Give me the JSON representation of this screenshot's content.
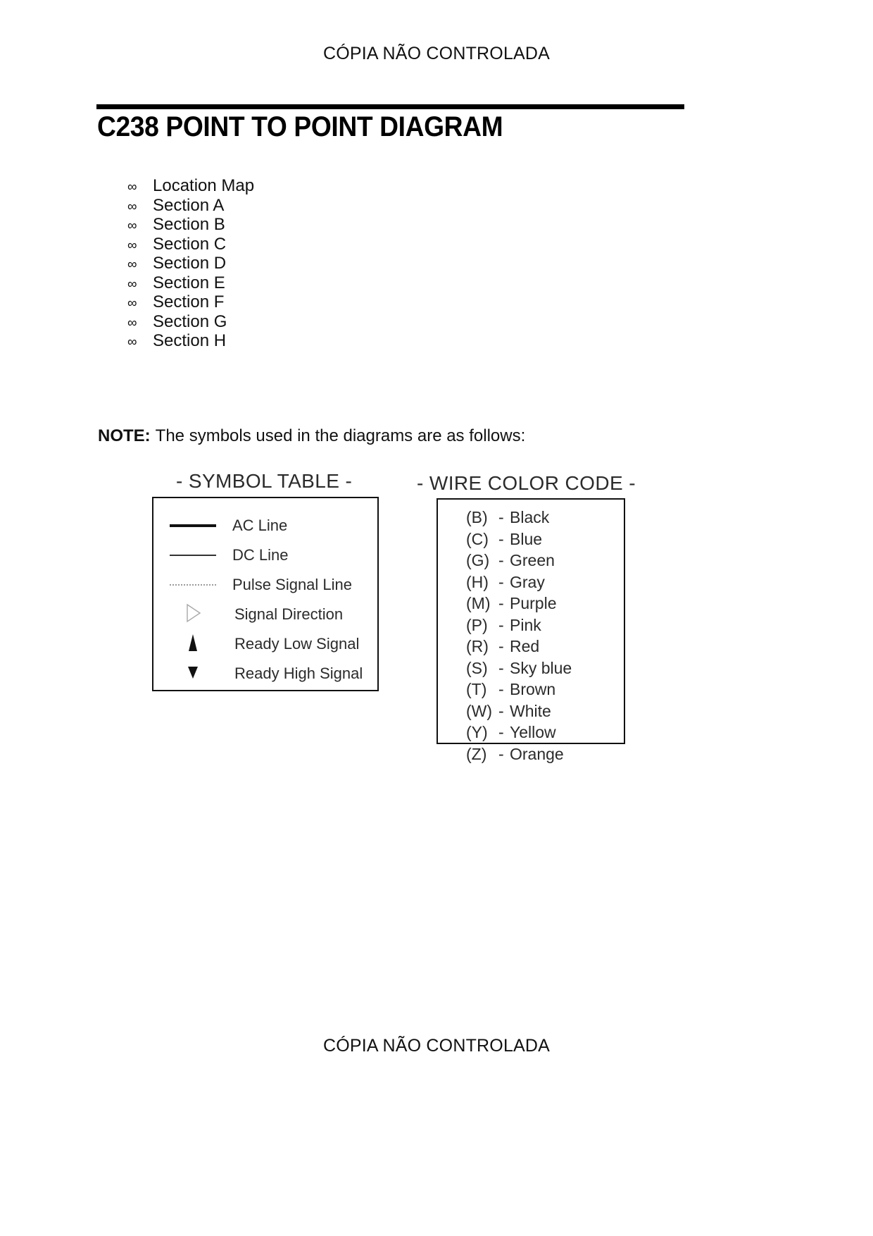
{
  "header": {
    "watermark": "CÓPIA NÃO CONTROLADA"
  },
  "footer": {
    "watermark": "CÓPIA NÃO CONTROLADA"
  },
  "title": "C238 POINT TO POINT DIAGRAM",
  "section_list": {
    "bullet_glyph": "∞",
    "items": [
      {
        "label": "Location Map"
      },
      {
        "label": "Section A"
      },
      {
        "label": "Section B"
      },
      {
        "label": "Section C"
      },
      {
        "label": "Section D"
      },
      {
        "label": "Section E"
      },
      {
        "label": "Section F"
      },
      {
        "label": "Section G"
      },
      {
        "label": "Section H"
      }
    ]
  },
  "note": {
    "keyword": "NOTE:",
    "text": "The symbols used in the diagrams are as follows:"
  },
  "symbol_table": {
    "heading": "- SYMBOL TABLE -",
    "rows": [
      {
        "symbol": "solid-thick-line",
        "label": "AC Line"
      },
      {
        "symbol": "solid-thin-line",
        "label": "DC Line"
      },
      {
        "symbol": "dotted-line",
        "label": "Pulse Signal Line"
      },
      {
        "symbol": "hollow-right-triangle",
        "label": "Signal Direction"
      },
      {
        "symbol": "filled-up-triangle",
        "label": "Ready Low Signal"
      },
      {
        "symbol": "filled-down-triangle",
        "label": "Ready High Signal"
      }
    ]
  },
  "wire_color_code": {
    "heading": "- WIRE COLOR CODE -",
    "entries": [
      {
        "code": "(B)",
        "dash": "-",
        "color": "Black"
      },
      {
        "code": "(C)",
        "dash": "-",
        "color": "Blue"
      },
      {
        "code": "(G)",
        "dash": "-",
        "color": "Green"
      },
      {
        "code": "(H)",
        "dash": "-",
        "color": "Gray"
      },
      {
        "code": "(M)",
        "dash": "-",
        "color": "Purple"
      },
      {
        "code": "(P)",
        "dash": "-",
        "color": "Pink"
      },
      {
        "code": "(R)",
        "dash": "-",
        "color": "Red"
      },
      {
        "code": "(S)",
        "dash": "-",
        "color": "Sky blue"
      },
      {
        "code": "(T)",
        "dash": "-",
        "color": "Brown"
      },
      {
        "code": "(W)",
        "dash": "-",
        "color": "White"
      },
      {
        "code": "(Y)",
        "dash": "-",
        "color": "Yellow"
      },
      {
        "code": "(Z)",
        "dash": "-",
        "color": "Orange"
      }
    ]
  }
}
